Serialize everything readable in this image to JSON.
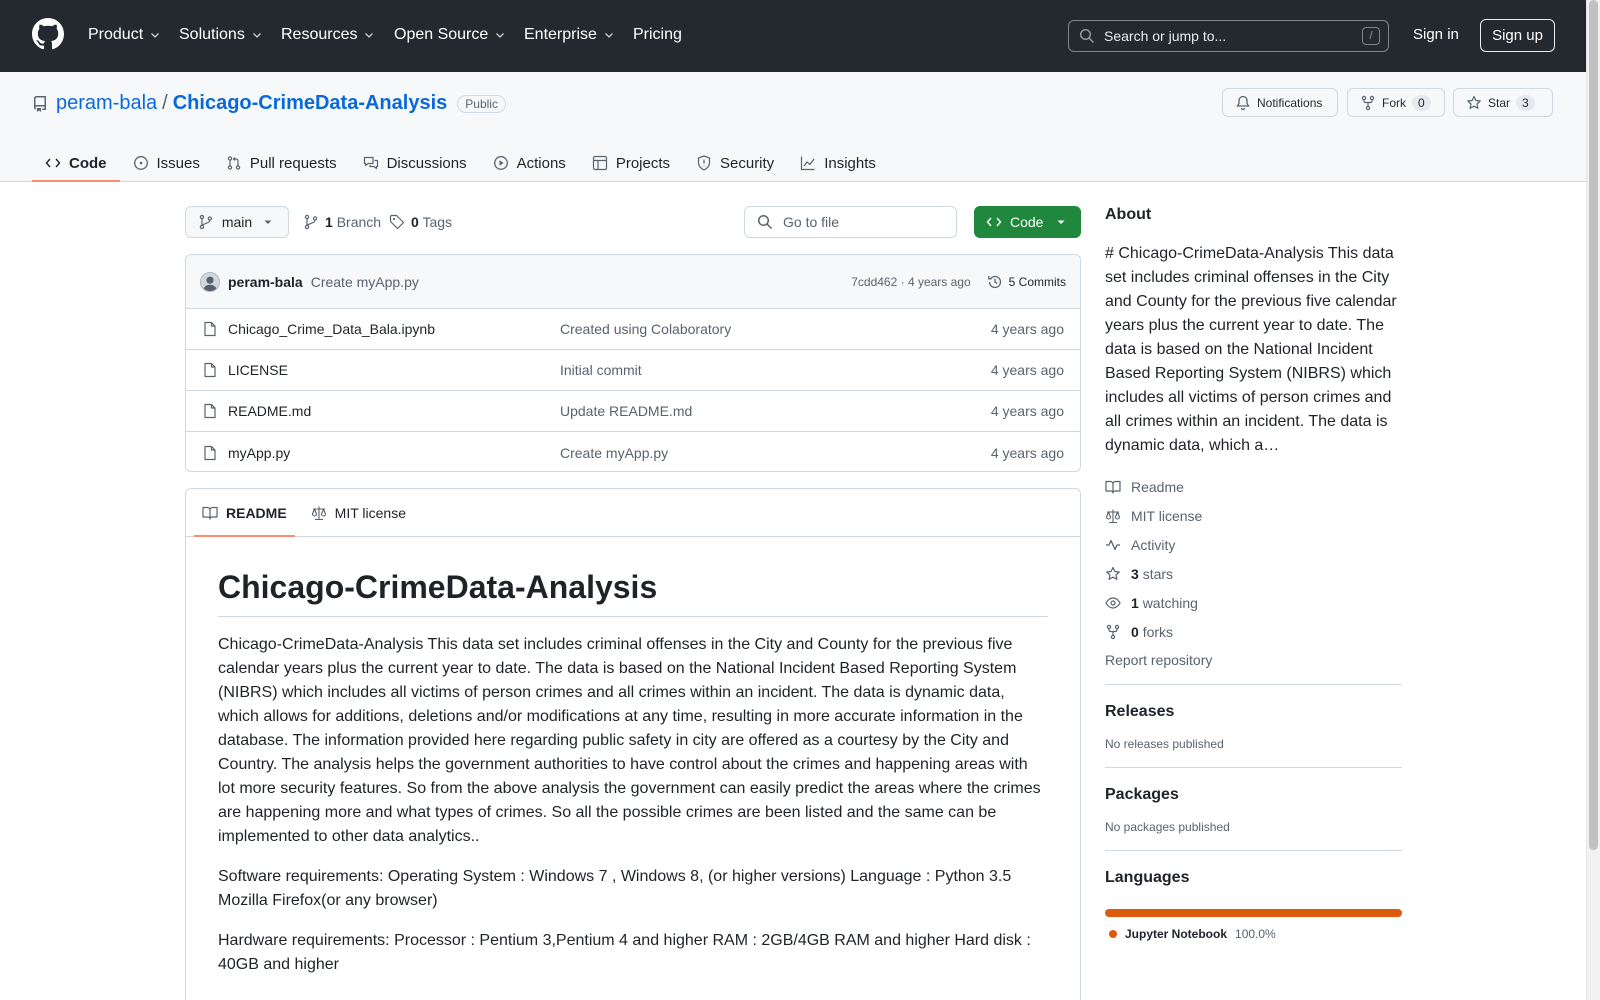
{
  "header": {
    "nav": [
      {
        "label": "Product",
        "dropdown": true
      },
      {
        "label": "Solutions",
        "dropdown": true
      },
      {
        "label": "Resources",
        "dropdown": true
      },
      {
        "label": "Open Source",
        "dropdown": true
      },
      {
        "label": "Enterprise",
        "dropdown": true
      },
      {
        "label": "Pricing",
        "dropdown": false
      }
    ],
    "search_placeholder": "Search or jump to...",
    "search_key": "/",
    "signin": "Sign in",
    "signup": "Sign up"
  },
  "repo": {
    "owner": "peram-bala",
    "separator": "/",
    "name": "Chicago-CrimeData-Analysis",
    "visibility": "Public",
    "notifications_label": "Notifications",
    "fork_label": "Fork",
    "fork_count": "0",
    "star_label": "Star",
    "star_count": "3",
    "tabs": [
      {
        "label": "Code",
        "icon": "code-icon",
        "selected": true
      },
      {
        "label": "Issues",
        "icon": "issue-icon",
        "selected": false
      },
      {
        "label": "Pull requests",
        "icon": "pull-request-icon",
        "selected": false
      },
      {
        "label": "Discussions",
        "icon": "discussions-icon",
        "selected": false
      },
      {
        "label": "Actions",
        "icon": "play-icon",
        "selected": false
      },
      {
        "label": "Projects",
        "icon": "table-icon",
        "selected": false
      },
      {
        "label": "Security",
        "icon": "shield-icon",
        "selected": false
      },
      {
        "label": "Insights",
        "icon": "graph-icon",
        "selected": false
      }
    ]
  },
  "toolbar": {
    "branch": "main",
    "branch_count": "1",
    "branch_label": "Branch",
    "tag_count": "0",
    "tag_label": "Tags",
    "goto_placeholder": "Go to file",
    "code_button": "Code"
  },
  "latest_commit": {
    "author": "peram-bala",
    "message": "Create myApp.py",
    "hash_age": "7cdd462 · 4 years ago",
    "commits_label": "5 Commits"
  },
  "files": [
    {
      "name": "Chicago_Crime_Data_Bala.ipynb",
      "message": "Created using Colaboratory",
      "age": "4 years ago"
    },
    {
      "name": "LICENSE",
      "message": "Initial commit",
      "age": "4 years ago"
    },
    {
      "name": "README.md",
      "message": "Update README.md",
      "age": "4 years ago"
    },
    {
      "name": "myApp.py",
      "message": "Create myApp.py",
      "age": "4 years ago"
    }
  ],
  "readme": {
    "tab_readme": "README",
    "tab_license": "MIT license",
    "title": "Chicago-CrimeData-Analysis",
    "paragraphs": [
      "Chicago-CrimeData-Analysis This data set includes criminal offenses in the City and County for the previous five calendar years plus the current year to date. The data is based on the National Incident Based Reporting System (NIBRS) which includes all victims of person crimes and all crimes within an incident. The data is dynamic data, which allows for additions, deletions and/or modifications at any time, resulting in more accurate information in the database. The information provided here regarding public safety in city are offered as a courtesy by the City and Country. The analysis helps the government authorities to have control about the crimes and happening areas with lot more security features. So from the above analysis the government can easily predict the areas where the crimes are happening more and what types of crimes. So all the possible crimes are been listed and the same can be implemented to other data analytics..",
      "Software requirements: Operating System : Windows 7 , Windows 8, (or higher versions) Language : Python 3.5 Mozilla Firefox(or any browser)",
      "Hardware requirements: Processor : Pentium 3,Pentium 4 and higher RAM : 2GB/4GB RAM and higher Hard disk : 40GB and higher"
    ]
  },
  "sidebar": {
    "about_title": "About",
    "about_desc": "# Chicago-CrimeData-Analysis This data set includes criminal offenses in the City and County for the previous five calendar years plus the current year to date. The data is based on the National Incident Based Reporting System (NIBRS) which includes all victims of person crimes and all crimes within an incident. The data is dynamic data, which a…",
    "readme": "Readme",
    "license": "MIT license",
    "activity": "Activity",
    "stars_count": "3",
    "stars_label": "stars",
    "watching_count": "1",
    "watching_label": "watching",
    "forks_count": "0",
    "forks_label": "forks",
    "report": "Report repository",
    "releases_title": "Releases",
    "releases_empty": "No releases published",
    "packages_title": "Packages",
    "packages_empty": "No packages published",
    "languages_title": "Languages",
    "language_name": "Jupyter Notebook",
    "language_pct": "100.0%",
    "language_fraction": 1.0,
    "language_color": "#DA5B0B"
  },
  "colors": {
    "header_bg": "#24292f",
    "link": "#0969da",
    "primary_button": "#1f883d",
    "tab_underline": "#fd8c73"
  }
}
